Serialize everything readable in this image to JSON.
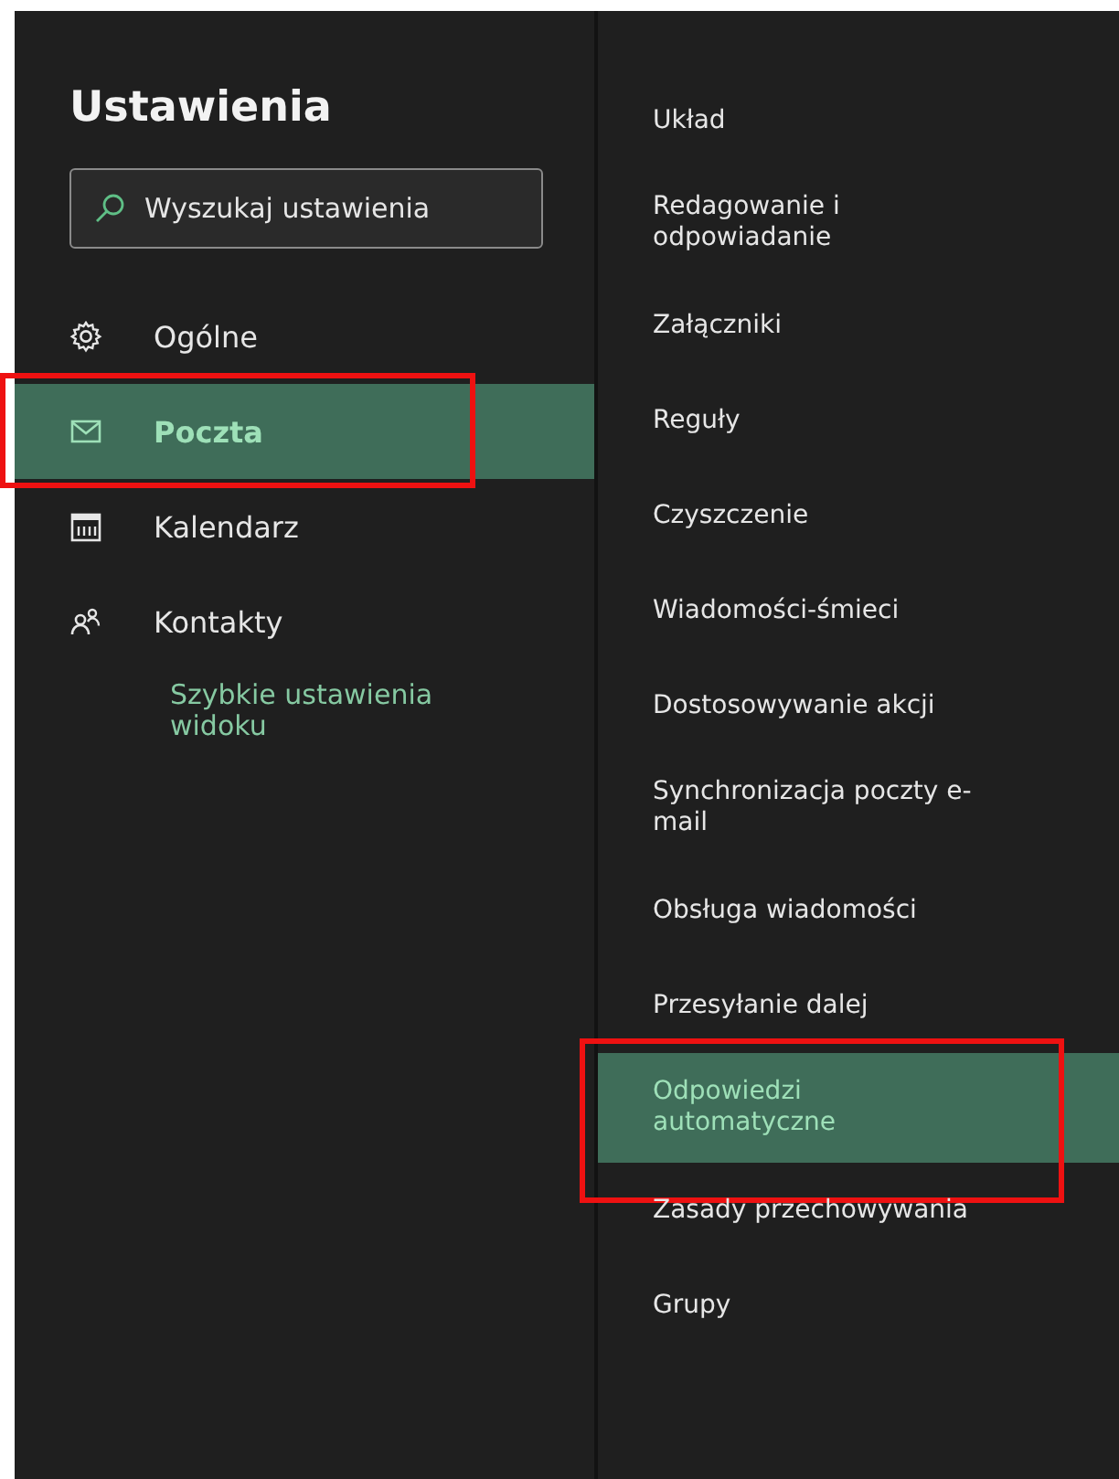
{
  "title": "Ustawienia",
  "search": {
    "placeholder": "Wyszukaj ustawienia"
  },
  "categories": [
    {
      "label": "Ogólne",
      "selected": false,
      "annotated": false
    },
    {
      "label": "Poczta",
      "selected": true,
      "annotated": true
    },
    {
      "label": "Kalendarz",
      "selected": false,
      "annotated": false
    },
    {
      "label": "Kontakty",
      "selected": false,
      "annotated": false
    }
  ],
  "quick_link": "Szybkie ustawienia widoku",
  "subcategories": [
    {
      "label": "Układ",
      "selected": false,
      "annotated": false
    },
    {
      "label": "Redagowanie i odpowiadanie",
      "selected": false,
      "annotated": false
    },
    {
      "label": "Załączniki",
      "selected": false,
      "annotated": false
    },
    {
      "label": "Reguły",
      "selected": false,
      "annotated": false
    },
    {
      "label": "Czyszczenie",
      "selected": false,
      "annotated": false
    },
    {
      "label": "Wiadomości-śmieci",
      "selected": false,
      "annotated": false
    },
    {
      "label": "Dostosowywanie akcji",
      "selected": false,
      "annotated": false
    },
    {
      "label": "Synchronizacja poczty e-mail",
      "selected": false,
      "annotated": false
    },
    {
      "label": "Obsługa wiadomości",
      "selected": false,
      "annotated": false
    },
    {
      "label": "Przesyłanie dalej",
      "selected": false,
      "annotated": false
    },
    {
      "label": "Odpowiedzi automatyczne",
      "selected": true,
      "annotated": true
    },
    {
      "label": "Zasady przechowywania",
      "selected": false,
      "annotated": false
    },
    {
      "label": "Grupy",
      "selected": false,
      "annotated": false
    }
  ]
}
